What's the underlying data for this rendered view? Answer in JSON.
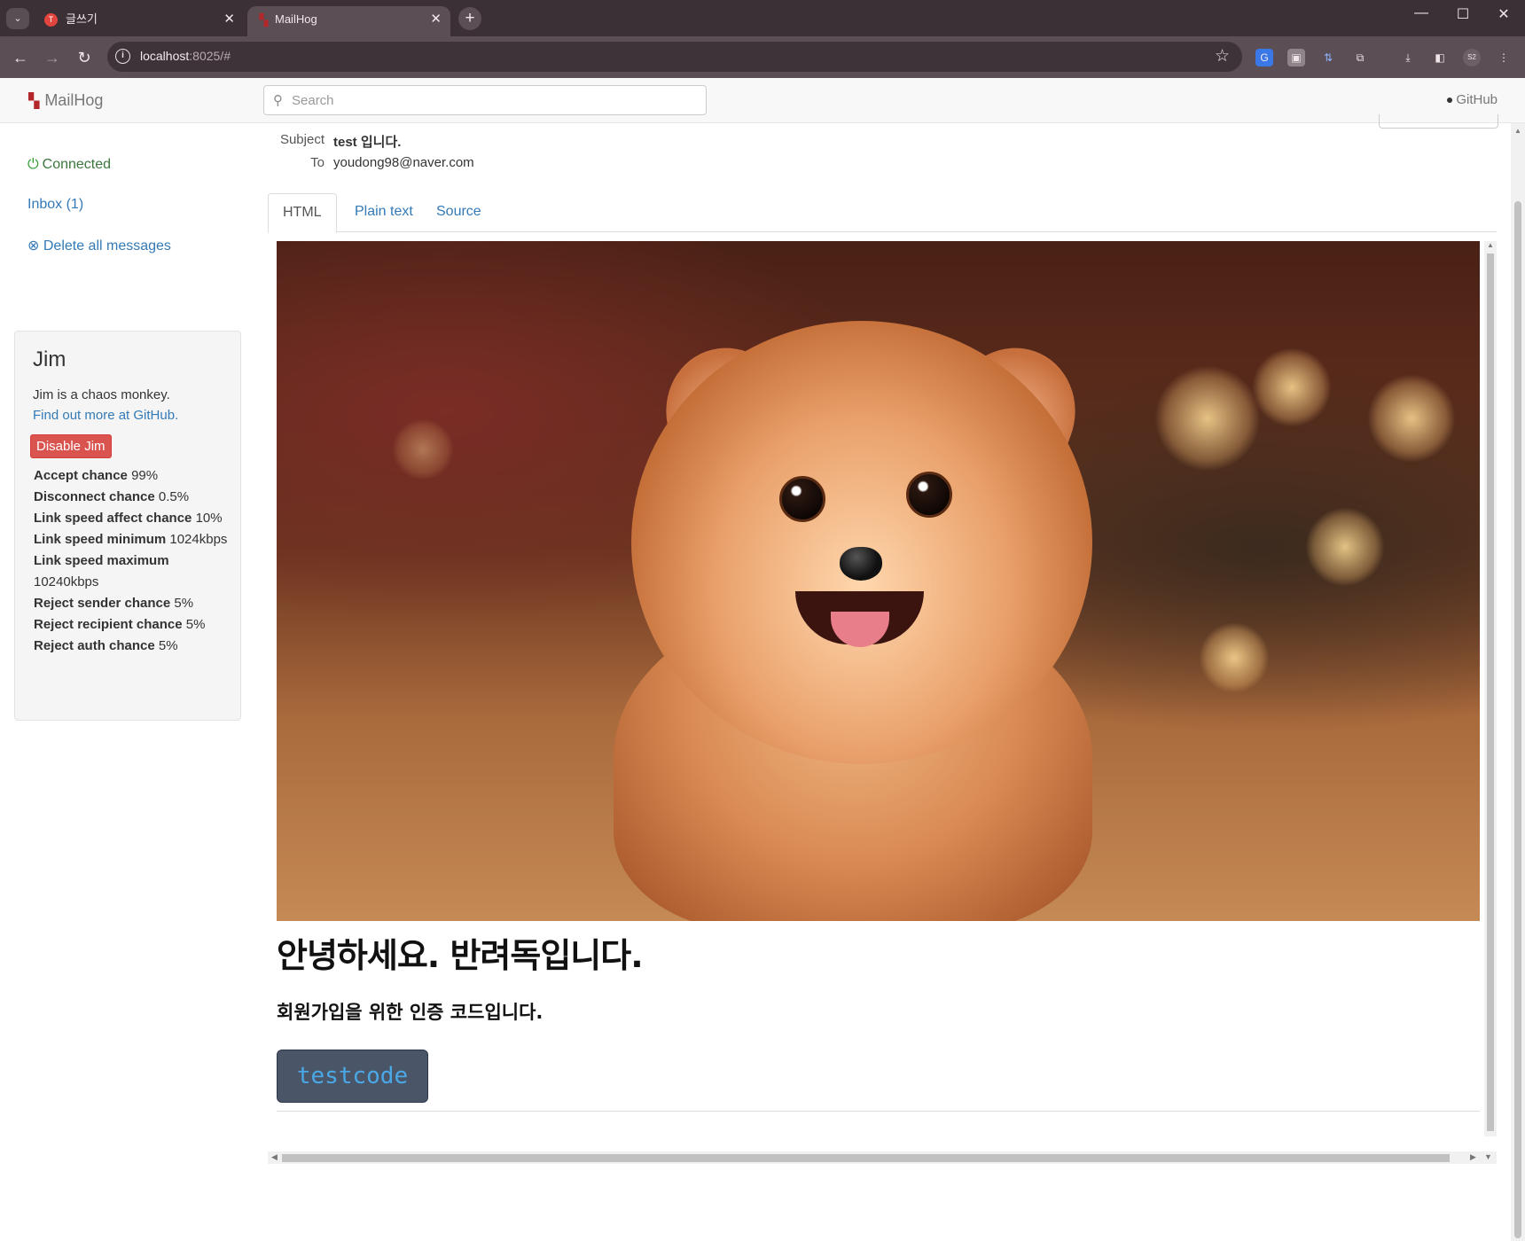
{
  "browser": {
    "tabs": [
      {
        "title": "글쓰기",
        "favicon": "T",
        "active": false
      },
      {
        "title": "MailHog",
        "favicon": "🐖",
        "active": true
      }
    ],
    "url_host": "localhost",
    "url_rest": ":8025/#",
    "profile_label": "S2"
  },
  "app": {
    "brand": "MailHog",
    "search_placeholder": "Search",
    "github_label": "GitHub"
  },
  "sidebar": {
    "connected": "Connected",
    "inbox": "Inbox (1)",
    "delete_all": "Delete all messages"
  },
  "jim": {
    "title": "Jim",
    "description": "Jim is a chaos monkey.",
    "link": "Find out more at GitHub.",
    "button": "Disable Jim",
    "settings": [
      {
        "label": "Accept chance",
        "value": "99%"
      },
      {
        "label": "Disconnect chance",
        "value": "0.5%"
      },
      {
        "label": "Link speed affect chance",
        "value": "10%"
      },
      {
        "label": "Link speed minimum",
        "value": "1024kbps"
      },
      {
        "label": "Link speed maximum",
        "value": "10240kbps"
      },
      {
        "label": "Reject sender chance",
        "value": "5%"
      },
      {
        "label": "Reject recipient chance",
        "value": "5%"
      },
      {
        "label": "Reject auth chance",
        "value": "5%"
      }
    ]
  },
  "message": {
    "subject_label": "Subject",
    "subject": "test 입니다.",
    "to_label": "To",
    "to": "youdong98@naver.com",
    "tabs": [
      "HTML",
      "Plain text",
      "Source"
    ],
    "active_tab": "HTML",
    "body": {
      "heading": "안녕하세요. 반려독입니다.",
      "subheading": "회원가입을 위한 인증 코드입니다.",
      "code": "testcode"
    }
  },
  "colors": {
    "link": "#337ab7",
    "danger": "#d9534f",
    "connected": "#3c763d",
    "code_button_bg": "#4a5568",
    "code_text": "#4aa8e6"
  }
}
